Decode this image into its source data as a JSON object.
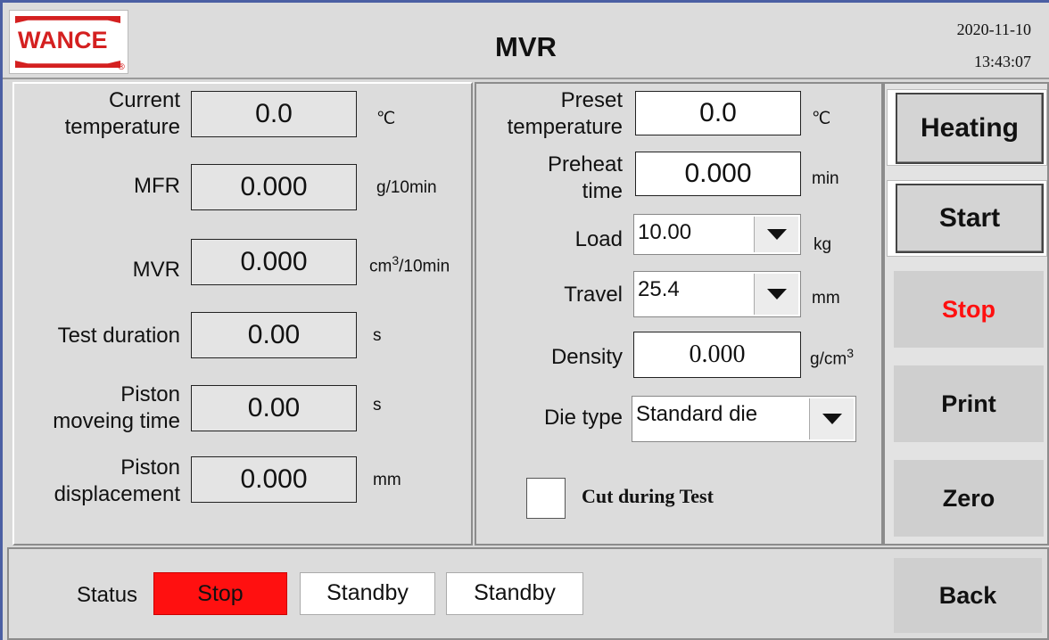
{
  "header": {
    "logo_text": "WANCE",
    "logo_reg": "®",
    "title": "MVR",
    "date": "2020-11-10",
    "time": "13:43:07"
  },
  "left": {
    "current_temperature": {
      "label_1": "Current",
      "label_2": "temperature",
      "value": "0.0",
      "unit": "℃"
    },
    "mfr": {
      "label": "MFR",
      "value": "0.000",
      "unit": "g/10min"
    },
    "mvr": {
      "label": "MVR",
      "value": "0.000",
      "unit_pre": "cm",
      "unit_sup": "3",
      "unit_post": "/10min"
    },
    "test_duration": {
      "label": "Test duration",
      "value": "0.00",
      "unit": "s"
    },
    "piston_moving_time": {
      "label_1": "Piston",
      "label_2": "moveing time",
      "value": "0.00",
      "unit": "s"
    },
    "piston_displacement": {
      "label_1": "Piston",
      "label_2": "displacement",
      "value": "0.000",
      "unit": "mm"
    }
  },
  "middle": {
    "preset_temperature": {
      "label_1": "Preset",
      "label_2": "temperature",
      "value": "0.0",
      "unit": "℃"
    },
    "preheat_time": {
      "label_1": "Preheat",
      "label_2": "time",
      "value": "0.000",
      "unit": "min"
    },
    "load": {
      "label": "Load",
      "value": "10.00",
      "unit": "kg"
    },
    "travel": {
      "label": "Travel",
      "value": "25.4",
      "unit": "mm"
    },
    "density": {
      "label": "Density",
      "value": "0.000",
      "unit_pre": "g/cm",
      "unit_sup": "3"
    },
    "die_type": {
      "label": "Die type",
      "value": "Standard die"
    },
    "cut_during_test": {
      "label": "Cut during Test",
      "checked": false
    }
  },
  "buttons": {
    "heating": "Heating",
    "start": "Start",
    "stop": "Stop",
    "print": "Print",
    "zero": "Zero",
    "back": "Back"
  },
  "status": {
    "label": "Status",
    "items": [
      "Stop",
      "Standby",
      "Standby"
    ]
  },
  "colors": {
    "stop_red": "#ff1010",
    "logo_red": "#d42020",
    "frame_blue": "#4b5fa3"
  },
  "icons": {
    "dropdown": "chevron-down-icon",
    "logo": "wance-logo"
  }
}
